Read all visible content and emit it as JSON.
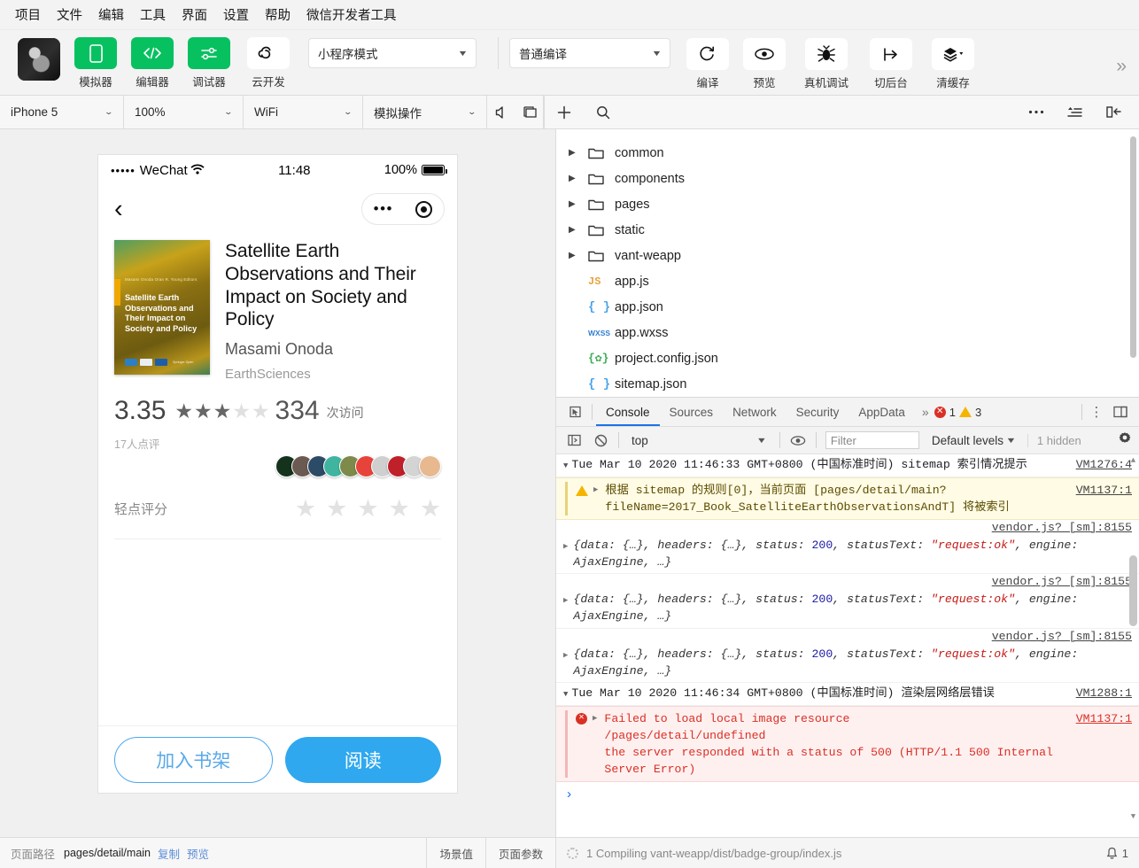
{
  "menubar": {
    "items": [
      "项目",
      "文件",
      "编辑",
      "工具",
      "界面",
      "设置",
      "帮助",
      "微信开发者工具"
    ]
  },
  "toolbar": {
    "avatar_name": "user-avatar",
    "buttons": [
      {
        "label": "模拟器",
        "icon": "phone-icon"
      },
      {
        "label": "编辑器",
        "icon": "code-icon"
      },
      {
        "label": "调试器",
        "icon": "sliders-icon"
      },
      {
        "label": "云开发",
        "icon": "cloud-icon"
      }
    ],
    "mode_select": "小程序模式",
    "compile_select": "普通编译",
    "actions": [
      {
        "label": "编译",
        "icon": "refresh-icon"
      },
      {
        "label": "预览",
        "icon": "eye-icon"
      },
      {
        "label": "真机调试",
        "icon": "bug-icon"
      },
      {
        "label": "切后台",
        "icon": "background-icon"
      },
      {
        "label": "清缓存",
        "icon": "layers-icon"
      }
    ],
    "overflow": "»"
  },
  "devicebar": {
    "device": "iPhone 5",
    "zoom": "100%",
    "network": "WiFi",
    "simulate": "模拟操作",
    "icons": [
      "mute-icon",
      "window-icon"
    ],
    "editor_icons": [
      "add-icon",
      "search-icon",
      "more-icon",
      "outline-icon",
      "collapse-icon"
    ]
  },
  "simulator": {
    "status": {
      "carrier_dots": "•••••",
      "carrier": "WeChat",
      "wifi": "wifi-icon",
      "time": "11:48",
      "battery_pct": "100%"
    },
    "nav": {
      "back": "‹",
      "more": "•••",
      "target": "target-icon"
    },
    "book": {
      "cover_author": "Masami Onoda\nOran R. Young  Editors",
      "cover_title": "Satellite Earth Observations and Their Impact on Society and Policy",
      "cover_publisher": "Springer Open",
      "title": "Satellite Earth Observations and Their Impact on Society and Policy",
      "author": "Masami Onoda",
      "category": "EarthSciences"
    },
    "rating": {
      "score": "3.35",
      "stars_filled": 3,
      "stars_total": 5,
      "visits": "334",
      "visits_label": "次访问",
      "review_count": "17人点评",
      "my_rating_label": "轻点评分",
      "my_stars_total": 5,
      "avatar_colors": [
        "#14321c",
        "#6b5a52",
        "#2b4b66",
        "#3fb5a0",
        "#7d8a4a",
        "#e8433a",
        "#cfcfcf",
        "#c0202a",
        "#d4d4d4",
        "#e8b98f"
      ]
    },
    "actions": {
      "shelf": "加入书架",
      "read": "阅读"
    },
    "footer": {
      "path_label": "页面路径",
      "path_value": "pages/detail/main",
      "copy": "复制",
      "preview": "预览",
      "scene": "场景值",
      "params": "页面参数"
    }
  },
  "filetree": {
    "rows": [
      {
        "name": "common",
        "type": "folder",
        "expandable": true
      },
      {
        "name": "components",
        "type": "folder",
        "expandable": true
      },
      {
        "name": "pages",
        "type": "folder",
        "expandable": true
      },
      {
        "name": "static",
        "type": "folder",
        "expandable": true
      },
      {
        "name": "vant-weapp",
        "type": "folder",
        "expandable": true
      },
      {
        "name": "app.js",
        "type": "js",
        "badge": "JS",
        "expandable": false
      },
      {
        "name": "app.json",
        "type": "json",
        "badge": "{ }",
        "expandable": false
      },
      {
        "name": "app.wxss",
        "type": "wxss",
        "badge": "WXSS",
        "expandable": false
      },
      {
        "name": "project.config.json",
        "type": "config",
        "badge": "{✿}",
        "expandable": false
      },
      {
        "name": "sitemap.json",
        "type": "json",
        "badge": "{ }",
        "expandable": false
      }
    ]
  },
  "devtools": {
    "tabs": [
      "Console",
      "Sources",
      "Network",
      "Security",
      "AppData"
    ],
    "active_tab": "Console",
    "overflow": "»",
    "error_count": "1",
    "warn_count": "3",
    "filters": {
      "context": "top",
      "filter_placeholder": "Filter",
      "levels": "Default levels",
      "hidden": "1 hidden"
    },
    "logs": [
      {
        "kind": "group",
        "text": "Tue Mar 10 2020 11:46:33 GMT+0800 (中国标准时间) sitemap 索引情况提示",
        "bold": "sitemap",
        "src": "VM1276:4"
      },
      {
        "kind": "warn",
        "line1": "根据 sitemap 的规则[0]，当前页面 [pages/detail/main?",
        "line2": "fileName=2017_Book_SatelliteEarthObservationsAndT] 将被索引",
        "src": "VM1137:1"
      },
      {
        "kind": "object",
        "src": "vendor.js? [sm]:8155",
        "pre": "{data: {…}, headers: {…}, status: ",
        "num": "200",
        "mid": ", statusText: ",
        "str": "\"request:ok\"",
        "post": ", engine: AjaxEngine, …}"
      },
      {
        "kind": "object",
        "src": "vendor.js? [sm]:8155",
        "pre": "{data: {…}, headers: {…}, status: ",
        "num": "200",
        "mid": ", statusText: ",
        "str": "\"request:ok\"",
        "post": ", engine: AjaxEngine, …}"
      },
      {
        "kind": "object",
        "src": "vendor.js? [sm]:8155",
        "pre": "{data: {…}, headers: {…}, status: ",
        "num": "200",
        "mid": ", statusText: ",
        "str": "\"request:ok\"",
        "post": ", engine: AjaxEngine, …}"
      },
      {
        "kind": "group",
        "text": "Tue Mar 10 2020 11:46:34 GMT+0800 (中国标准时间) 渲染层网络层错误",
        "src": "VM1288:1"
      },
      {
        "kind": "error",
        "line1": "Failed to load local image resource",
        "line2": "/pages/detail/undefined",
        "line3": " the server responded with a status of 500 (HTTP/1.1 500 Internal",
        "line4": "Server Error)",
        "src": "VM1137:1"
      }
    ],
    "prompt": "›",
    "footer": {
      "status": "1 Compiling vant-weapp/dist/badge-group/index.js",
      "notification_count": "1"
    }
  },
  "colors": {
    "accent_green": "#07c160",
    "accent_blue": "#2fa8ef",
    "tab_active": "#1a73e8",
    "error_red": "#d93025",
    "warn_yellow": "#f5b400"
  }
}
